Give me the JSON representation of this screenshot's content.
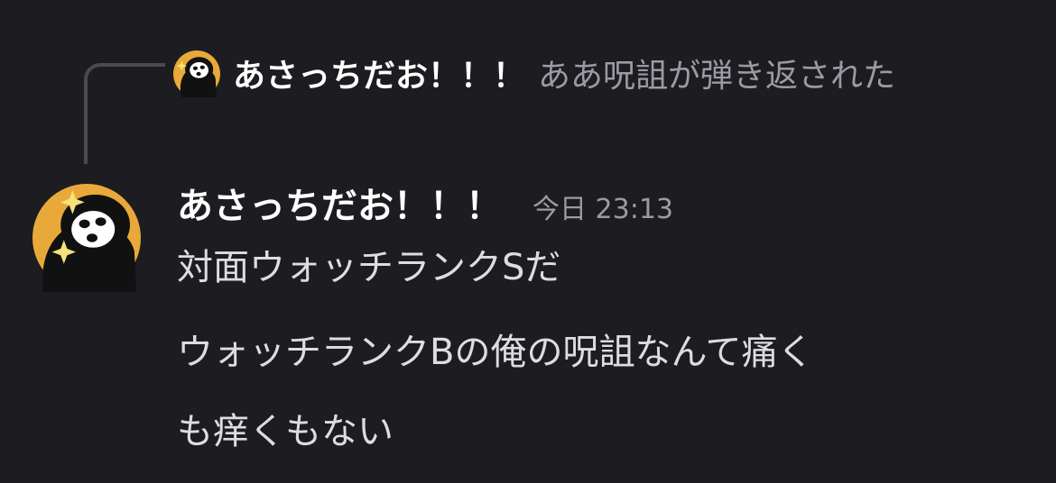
{
  "reply": {
    "author": "あさっちだお！！！",
    "text": "ああ呪詛が弾き返された",
    "avatar_icon": "masked-face-avatar-icon"
  },
  "message": {
    "author": "あさっちだお！！！",
    "timestamp": "今日 23:13",
    "avatar_icon": "masked-face-avatar-icon",
    "lines": [
      "対面ウォッチランクSだ",
      "ウォッチランクBの俺の呪詛なんて痛く",
      "も痒くもない"
    ]
  },
  "colors": {
    "background": "#1c1c21",
    "author": "#ffffff",
    "muted": "#9a9ba3",
    "body_text": "#dcdde1",
    "avatar_ring": "#e9a93a",
    "connector": "#4a4b52"
  }
}
